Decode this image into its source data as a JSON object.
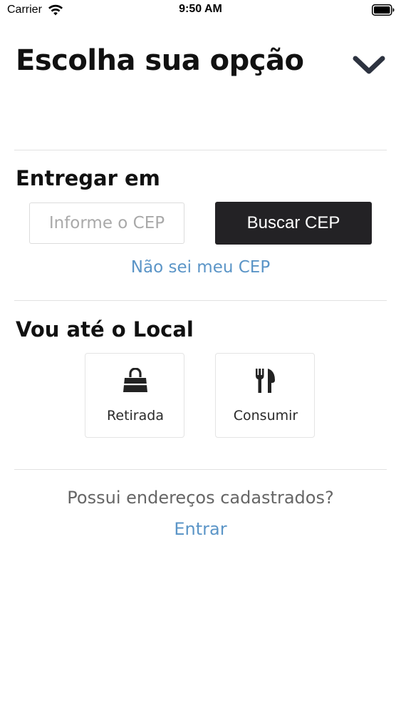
{
  "status_bar": {
    "carrier": "Carrier",
    "time": "9:50 AM",
    "icons": [
      "wifi-icon",
      "battery-icon"
    ]
  },
  "header": {
    "title": "Escolha sua opção",
    "collapse_icon": "chevron-down-icon"
  },
  "delivery": {
    "title": "Entregar em",
    "cep_placeholder": "Informe o CEP",
    "cep_value": "",
    "search_button_label": "Buscar CEP",
    "dont_know_cep_link": "Não sei meu CEP"
  },
  "local": {
    "title": "Vou até o Local",
    "options": [
      {
        "label": "Retirada",
        "icon": "shopping-bag-icon"
      },
      {
        "label": "Consumir",
        "icon": "fork-knife-icon"
      }
    ]
  },
  "account": {
    "question": "Possui endereços cadastrados?",
    "login_link": "Entrar"
  },
  "colors": {
    "accent_link": "#5b95c7",
    "button_dark": "#232225",
    "chevron": "#2d3340",
    "divider": "#e2e2e2"
  }
}
